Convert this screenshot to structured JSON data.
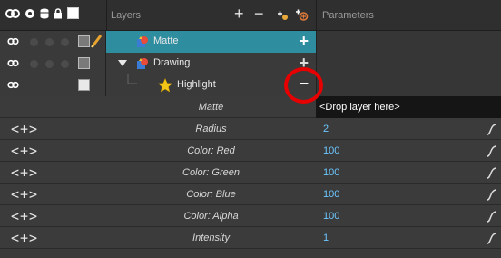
{
  "header": {
    "layers_title": "Layers",
    "parameters_title": "Parameters",
    "tools": {
      "add_layer": "+",
      "remove_layer": "−",
      "add_effect": "✚",
      "add_peg": "⊕"
    }
  },
  "layers": [
    {
      "name": "Matte",
      "action": "+",
      "selected": true,
      "icon": "matte-layer-icon"
    },
    {
      "name": "Drawing",
      "action": "+",
      "selected": false,
      "expanded": true,
      "icon": "drawing-layer-icon"
    },
    {
      "name": "Highlight",
      "action": "−",
      "selected": false,
      "icon": "highlight-star-icon"
    }
  ],
  "matte_param": {
    "label": "Matte",
    "drop_text": "<Drop layer here>"
  },
  "parameters": [
    {
      "arrows": "<+>",
      "label": "Radius",
      "value": "2"
    },
    {
      "arrows": "<+>",
      "label": "Color: Red",
      "value": "100"
    },
    {
      "arrows": "<+>",
      "label": "Color: Green",
      "value": "100"
    },
    {
      "arrows": "<+>",
      "label": "Color: Blue",
      "value": "100"
    },
    {
      "arrows": "<+>",
      "label": "Color: Alpha",
      "value": "100"
    },
    {
      "arrows": "<+>",
      "label": "Intensity",
      "value": "1"
    }
  ],
  "colors": {
    "selected_row": "#2e8ea0",
    "value_text": "#6cc6ff",
    "annotation": "#e60000"
  }
}
